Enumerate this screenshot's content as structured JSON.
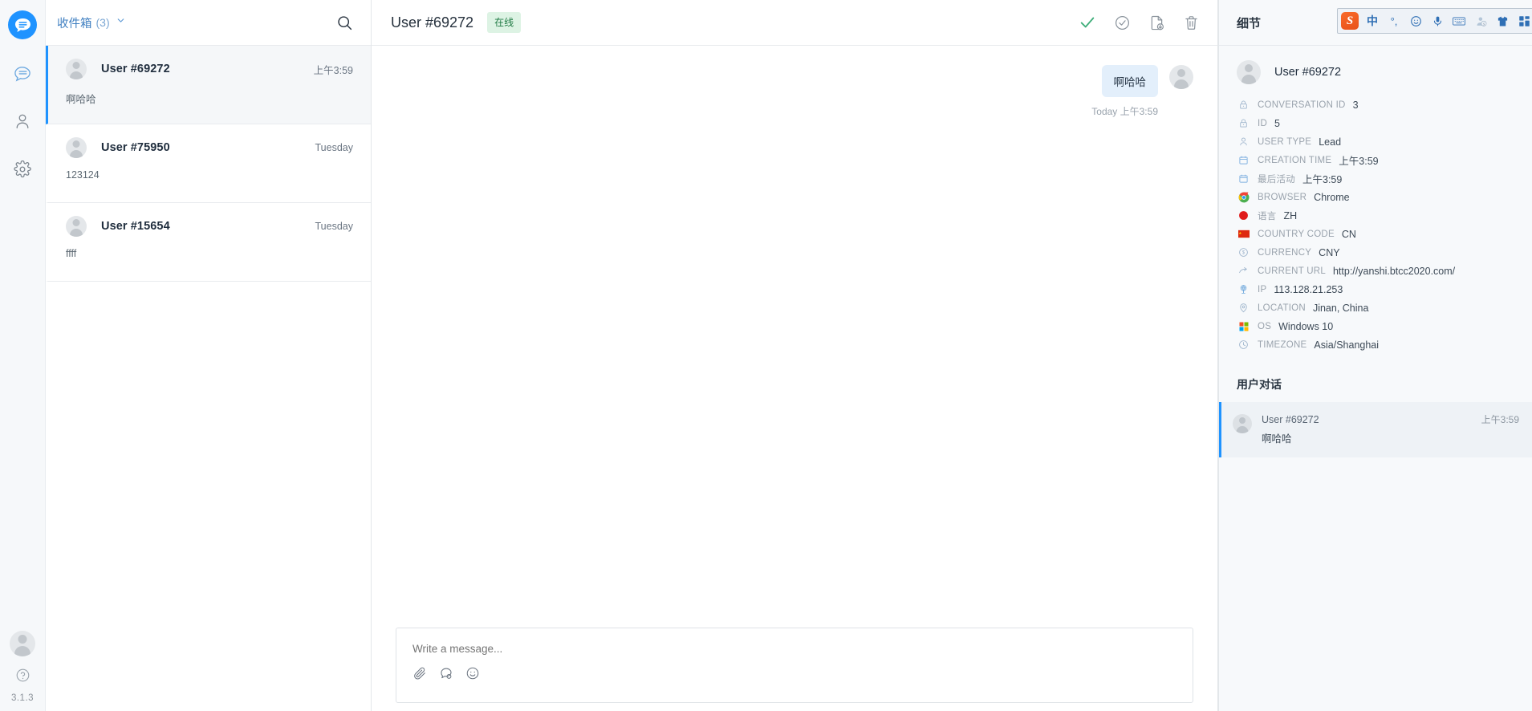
{
  "rail": {
    "logo_name": "chat-logo",
    "items": [
      {
        "name": "conversations",
        "icon": "chat-bubble-icon",
        "active": true
      },
      {
        "name": "contacts",
        "icon": "user-icon",
        "active": false
      },
      {
        "name": "settings",
        "icon": "gear-icon",
        "active": false
      }
    ],
    "help_icon": "question-mark-icon",
    "version": "3.1.3"
  },
  "conversation_list": {
    "inbox_label": "收件箱",
    "inbox_count": "(3)",
    "search_placeholder": "",
    "items": [
      {
        "name": "User #69272",
        "time": "上午3:59",
        "preview": "啊哈哈",
        "active": true
      },
      {
        "name": "User #75950",
        "time": "Tuesday",
        "preview": "123124",
        "active": false
      },
      {
        "name": "User #15654",
        "time": "Tuesday",
        "preview": "ffff",
        "active": false
      }
    ]
  },
  "chat": {
    "title": "User #69272",
    "status_badge": "在线",
    "actions": [
      {
        "label": "Resolve",
        "icon": "check-icon"
      },
      {
        "label": "Snooze",
        "icon": "circle-check-icon"
      },
      {
        "label": "Export transcript",
        "icon": "document-download-icon"
      },
      {
        "label": "Delete",
        "icon": "trash-icon"
      }
    ],
    "messages": [
      {
        "text": "啊哈哈",
        "side": "right",
        "meta": "Today 上午3:59"
      }
    ],
    "composer": {
      "placeholder": "Write a message...",
      "value": "",
      "tools": [
        {
          "label": "Attach file",
          "icon": "paperclip-icon"
        },
        {
          "label": "Saved replies",
          "icon": "saved-reply-icon"
        },
        {
          "label": "Emoji",
          "icon": "emoji-icon"
        }
      ]
    }
  },
  "details": {
    "title": "细节",
    "user_name": "User #69272",
    "rows": [
      {
        "icon": "lock-icon",
        "label": "CONVERSATION ID",
        "value": "3"
      },
      {
        "icon": "lock-icon",
        "label": "ID",
        "value": "5"
      },
      {
        "icon": "user-icon",
        "label": "USER TYPE",
        "value": "Lead"
      },
      {
        "icon": "calendar-icon",
        "label": "CREATION TIME",
        "value": "上午3:59"
      },
      {
        "icon": "calendar-icon",
        "label": "最后活动",
        "value": "上午3:59"
      },
      {
        "icon": "chrome-icon",
        "label": "BROWSER",
        "value": "Chrome"
      },
      {
        "icon": "language-flag-icon",
        "label": "语言",
        "value": "ZH"
      },
      {
        "icon": "china-flag-icon",
        "label": "COUNTRY CODE",
        "value": "CN"
      },
      {
        "icon": "currency-icon",
        "label": "CURRENCY",
        "value": "CNY"
      },
      {
        "icon": "link-arrow-icon",
        "label": "CURRENT URL",
        "value": "http://yanshi.btcc2020.com/"
      },
      {
        "icon": "globe-pin-icon",
        "label": "IP",
        "value": "113.128.21.253"
      },
      {
        "icon": "map-pin-icon",
        "label": "LOCATION",
        "value": "Jinan, China"
      },
      {
        "icon": "windows-icon",
        "label": "OS",
        "value": "Windows 10"
      },
      {
        "icon": "clock-icon",
        "label": "TIMEZONE",
        "value": "Asia/Shanghai"
      }
    ],
    "section_title": "用户对话",
    "conversations": [
      {
        "name": "User #69272",
        "time": "上午3:59",
        "text": "啊哈哈"
      }
    ]
  },
  "ime": {
    "logo": "S",
    "buttons": [
      {
        "name": "chinese-mode",
        "glyph": "中"
      },
      {
        "name": "punctuation-mode",
        "glyph": "°,"
      },
      {
        "name": "emoji-panel",
        "glyph": "☺"
      },
      {
        "name": "voice-input",
        "glyph": "mic"
      },
      {
        "name": "soft-keyboard",
        "glyph": "keyboard"
      },
      {
        "name": "handwriting",
        "glyph": "hand"
      },
      {
        "name": "skin",
        "glyph": "shirt"
      },
      {
        "name": "toolbox",
        "glyph": "grid"
      }
    ]
  },
  "colors": {
    "accent": "#1f93ff",
    "badge_bg": "#ddf3e4",
    "badge_text": "#1f7a43",
    "bubble": "#e3effb"
  }
}
